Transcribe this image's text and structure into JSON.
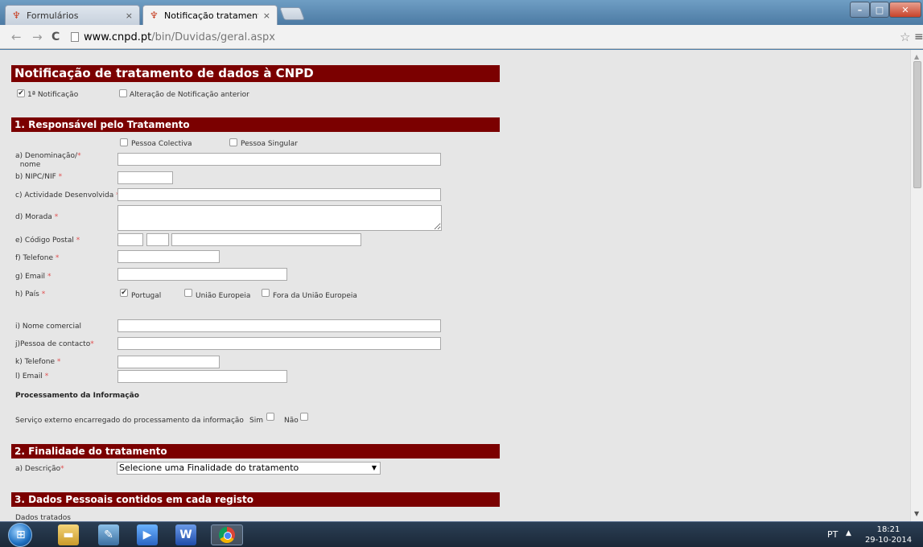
{
  "browser": {
    "tabs": [
      {
        "label": "Formulários",
        "active": false
      },
      {
        "label": "Notificação tratamento de",
        "active": true
      }
    ],
    "url_host": "www.cnpd.pt",
    "url_path": "/bin/Duvidas/geral.aspx"
  },
  "form": {
    "title": "Notificação de tratamento de dados à CNPD",
    "notif_first": "1ª Notificação",
    "notif_change": "Alteração de Notificação anterior",
    "section1": {
      "title": "1. Responsável pelo Tratamento",
      "pessoa_colectiva": "Pessoa Colectiva",
      "pessoa_singular": "Pessoa Singular",
      "denominacao_line1": "a) Denominação/",
      "denominacao_line2": "nome",
      "nipc": "b) NIPC/NIF",
      "actividade": "c) Actividade Desenvolvida",
      "morada": "d)  Morada",
      "codigo_postal": "e) Código Postal",
      "telefone": "f) Telefone",
      "email": "g) Email",
      "pais": "h) País",
      "pais_portugal": "Portugal",
      "pais_ue": "União Europeia",
      "pais_fora": "Fora da União Europeia",
      "nome_comercial": "i) Nome comercial",
      "pessoa_contacto": "j)Pessoa de contacto",
      "telefone2": "k) Telefone",
      "email2": "l) Email",
      "processamento_title": "Processamento da Informação",
      "servico_externo": "Serviço externo encarregado do processamento da informação",
      "sim": "Sim",
      "nao": "Não"
    },
    "section2": {
      "title": "2. Finalidade do tratamento",
      "descricao": "a) Descrição",
      "select_value": "Selecione uma Finalidade do tratamento"
    },
    "section3": {
      "title": "3. Dados Pessoais contidos em cada registo",
      "dados_tratados": "Dados tratados"
    },
    "required_mark": "*"
  },
  "taskbar": {
    "word_label": "W",
    "language": "PT",
    "time": "18:21",
    "date": "29-10-2014"
  }
}
